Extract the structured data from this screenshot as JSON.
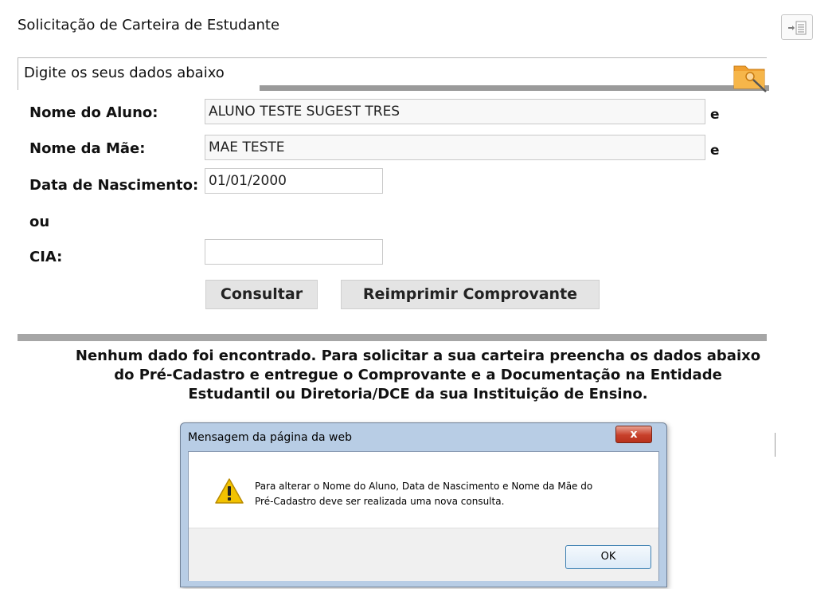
{
  "page": {
    "title": "Solicitação de Carteira de Estudante"
  },
  "panel": {
    "title": "Digite os seus dados abaixo"
  },
  "form": {
    "student_name_label": "Nome do Aluno:",
    "student_name_value": "ALUNO TESTE SUGEST TRES",
    "mother_name_label": "Nome da Mãe:",
    "mother_name_value": "MAE TESTE",
    "birth_date_label": "Data de Nascimento:",
    "birth_date_value": "01/01/2000",
    "or_label": "ou",
    "cia_label": "CIA:",
    "cia_value": "",
    "and_marker_1": "e",
    "and_marker_2": "e"
  },
  "buttons": {
    "consult": "Consultar",
    "reprint": "Reimprimir Comprovante"
  },
  "notice": {
    "line1": "Nenhum dado foi encontrado. Para solicitar a sua carteira preencha os dados abaixo",
    "line2": "do Pré-Cadastro e entregue o Comprovante e a Documentação na Entidade",
    "line3": "Estudantil ou Diretoria/DCE da sua Instituição de Ensino."
  },
  "dialog": {
    "title": "Mensagem da página da web",
    "close": "x",
    "message_line1": "Para alterar o Nome do Aluno, Data de Nascimento e Nome da Mãe do",
    "message_line2": "Pré-Cadastro deve ser realizada uma nova consulta.",
    "ok": "OK"
  },
  "icons": {
    "toggle": "list-toggle-icon",
    "folder": "folder-search-icon",
    "warning": "warning-icon"
  },
  "colors": {
    "divider": "#a6a6a6",
    "button_bg": "#e4e4e4",
    "dialog_frame": "#b8cde5",
    "close_button": "#c7402a",
    "warning": "#f2c200"
  }
}
